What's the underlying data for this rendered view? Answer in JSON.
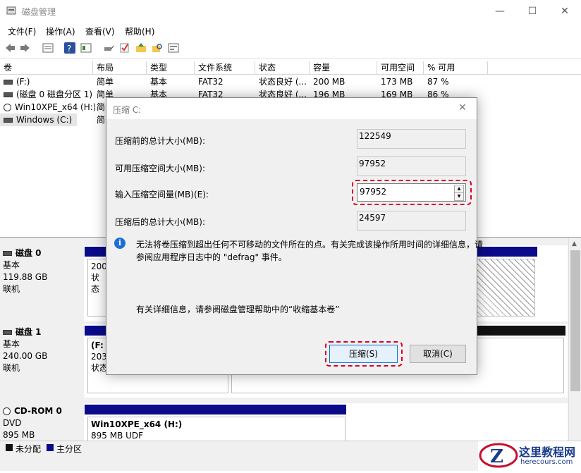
{
  "window": {
    "title": "磁盘管理"
  },
  "menu": [
    "文件(F)",
    "操作(A)",
    "查看(V)",
    "帮助(H)"
  ],
  "table": {
    "columns": [
      "卷",
      "布局",
      "类型",
      "文件系统",
      "状态",
      "容量",
      "可用空间",
      "% 可用"
    ],
    "rows": [
      [
        "(F:)",
        "简单",
        "基本",
        "FAT32",
        "状态良好 (...",
        "200 MB",
        "173 MB",
        "87 %"
      ],
      [
        "(磁盘 0 磁盘分区 1)",
        "简单",
        "基本",
        "FAT32",
        "状态良好 (...",
        "196 MB",
        "169 MB",
        "86 %"
      ],
      [
        "Win10XPE_x64 (H:)",
        "简",
        "",
        "",
        "",
        "",
        "",
        ""
      ],
      [
        "Windows (C:)",
        "简",
        "",
        "",
        "",
        "",
        "",
        ""
      ]
    ]
  },
  "disks": [
    {
      "name": "磁盘 0",
      "type": "基本",
      "size": "119.88 GB",
      "status": "联机",
      "part_lines": [
        "200",
        "状态"
      ]
    },
    {
      "name": "磁盘 1",
      "type": "基本",
      "size": "240.00 GB",
      "status": "联机",
      "part_lines": [
        "(F:",
        "203",
        "状态"
      ]
    },
    {
      "name": "CD-ROM 0",
      "type": "DVD",
      "size": "895 MB",
      "status": "",
      "part_lines": [
        "Win10XPE_x64  (H:)",
        "895 MB UDF"
      ]
    }
  ],
  "legend": [
    "未分配",
    "主分区"
  ],
  "dialog": {
    "title": "压缩 C:",
    "label_total_before": "压缩前的总计大小(MB):",
    "value_total_before": "122549",
    "label_available": "可用压缩空间大小(MB):",
    "value_available": "97952",
    "label_input": "输入压缩空间量(MB)(E):",
    "value_input": "97952",
    "label_total_after": "压缩后的总计大小(MB):",
    "value_total_after": "24597",
    "info_line1": "无法将卷压缩到超出任何不可移动的文件所在的点。有关完成该操作所用时间的详细信息，请",
    "info_line2": "参阅应用程序日志中的 \"defrag\" 事件。",
    "help_text": "有关详细信息，请参阅磁盘管理帮助中的“收缩基本卷”",
    "ok_label": "压缩(S)",
    "cancel_label": "取消(C)"
  },
  "watermark": {
    "title": "这里教程网",
    "url": "herecours.com"
  },
  "colors": {
    "primary_partition": "#0a0a8a",
    "highlight": "#d8002a",
    "info_icon": "#1a6fd6"
  }
}
